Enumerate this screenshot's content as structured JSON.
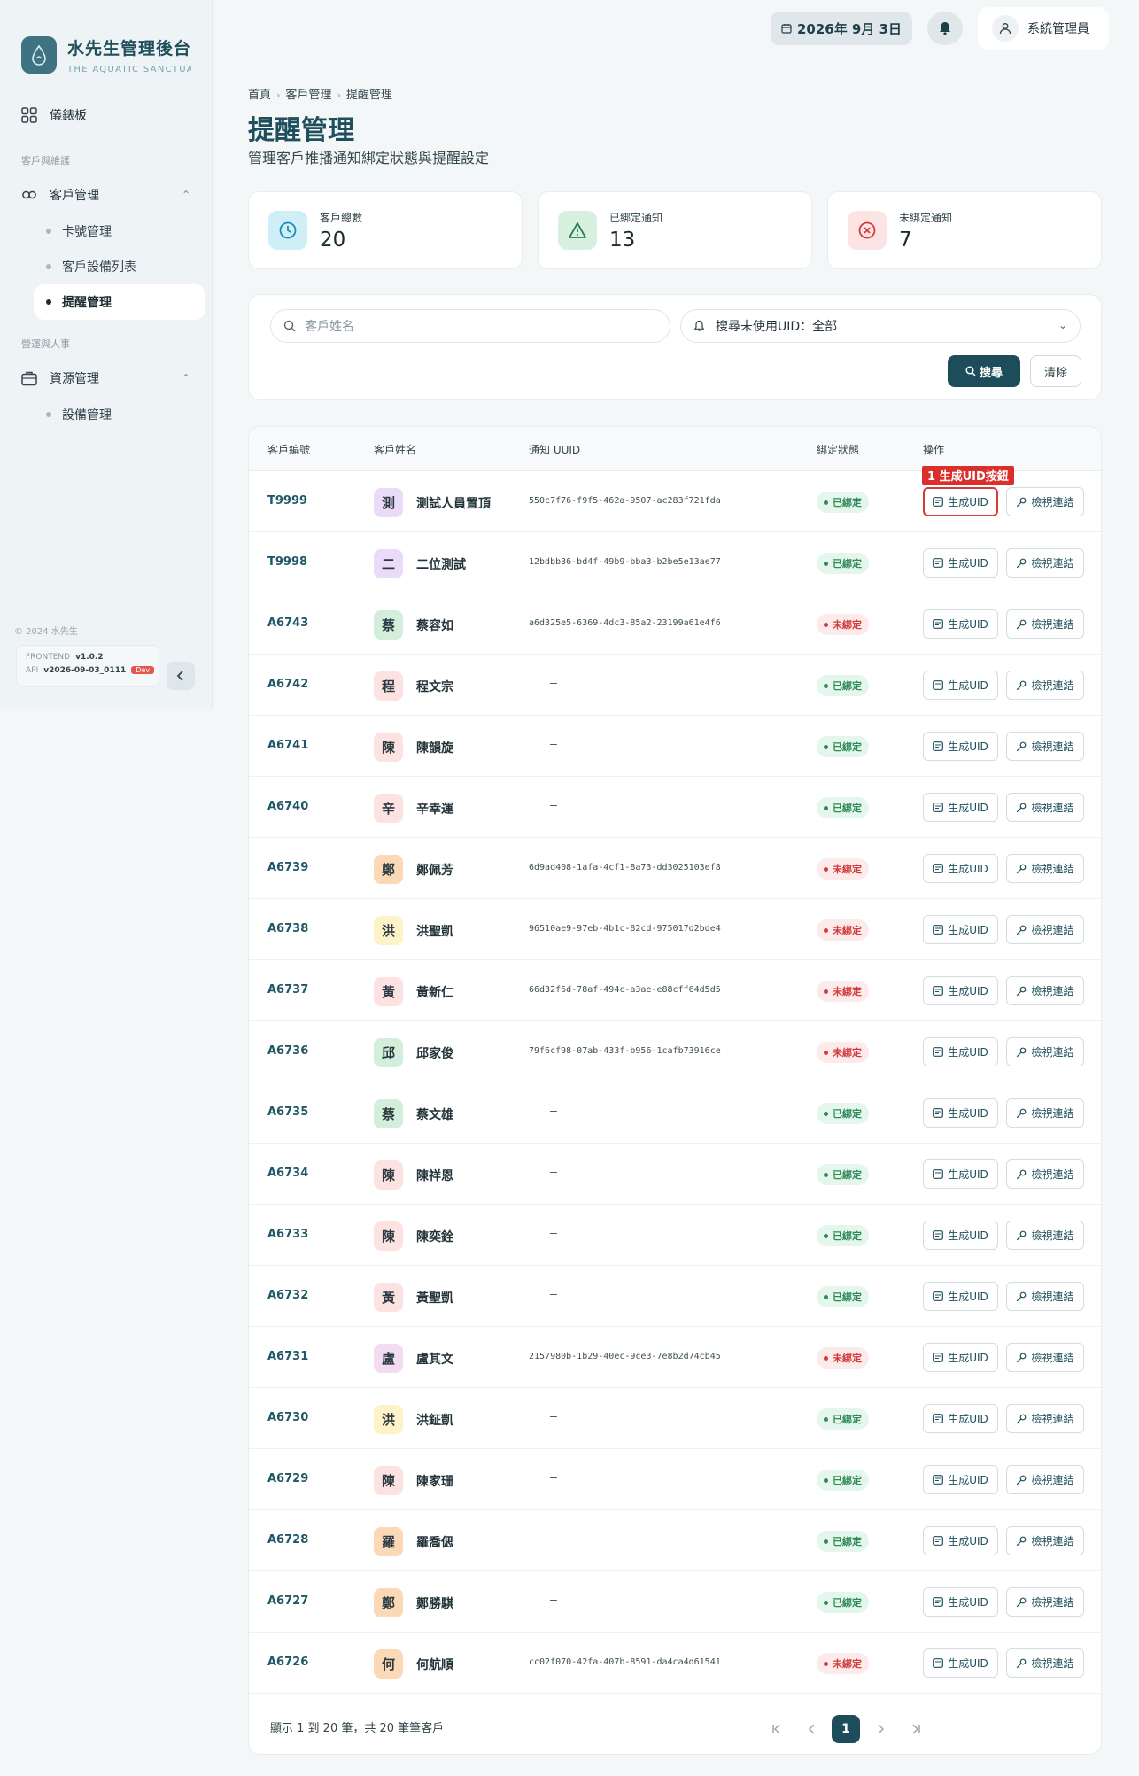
{
  "brand": {
    "title": "水先生管理後台",
    "subtitle": "THE AQUATIC SANCTUARY"
  },
  "sidebar": {
    "dashboard": "儀錶板",
    "section_customers": "客戶與維護",
    "customer_mgmt": "客戶管理",
    "sub_items": [
      "卡號管理",
      "客戶設備列表",
      "提醒管理"
    ],
    "section_ops": "營運與人事",
    "resource_mgmt": "資源管理",
    "resource_sub": "設備管理",
    "copyright": "© 2024 水先生",
    "frontend_label": "FRONTEND",
    "frontend_version": "v1.0.2",
    "api_label": "API",
    "api_version": "v2026-09-03_0111",
    "env_badge": "Dev"
  },
  "topbar": {
    "date": "2026年 9月 3日",
    "user": "系統管理員"
  },
  "header": {
    "breadcrumb": [
      "首頁",
      "客戶管理",
      "提醒管理"
    ],
    "title": "提醒管理",
    "subtitle": "管理客戶推播通知綁定狀態與提醒設定"
  },
  "stats": [
    {
      "label": "客戶總數",
      "value": "20",
      "icon": "clock-icon",
      "bg": "#cfeef8",
      "color": "#1b8fb8"
    },
    {
      "label": "已綁定通知",
      "value": "13",
      "icon": "warning-icon",
      "bg": "#d7f0e0",
      "color": "#2e7d4f"
    },
    {
      "label": "未綁定通知",
      "value": "7",
      "icon": "x-circle-icon",
      "bg": "#fde4e4",
      "color": "#d23b3b"
    }
  ],
  "filter": {
    "search_placeholder": "客戶姓名",
    "select_value": "搜尋未使用UID：全部",
    "search_button": "搜尋",
    "clear_button": "清除"
  },
  "table": {
    "headers": [
      "客戶編號",
      "客戶姓名",
      "通知 UUID",
      "綁定狀態",
      "操作"
    ],
    "uid_button": "生成UID",
    "link_button": "檢視連結",
    "bound_label": "已綁定",
    "unbound_label": "未綁定",
    "annotation": "1 生成UID按鈕",
    "rows": [
      {
        "id": "T9999",
        "initial": "測",
        "name": "測試人員置頂",
        "uuid": "550c7f76-f9f5-462a-9507-ac283f721fda",
        "bound": true,
        "avatar_bg": "#eadcf8"
      },
      {
        "id": "T9998",
        "initial": "二",
        "name": "二位測試",
        "uuid": "12bdbb36-bd4f-49b9-bba3-b2be5e13ae77",
        "bound": true,
        "avatar_bg": "#eadcf8"
      },
      {
        "id": "A6743",
        "initial": "蔡",
        "name": "蔡容如",
        "uuid": "a6d325e5-6369-4dc3-85a2-23199a61e4f6",
        "bound": false,
        "avatar_bg": "#d3efdc"
      },
      {
        "id": "A6742",
        "initial": "程",
        "name": "程文宗",
        "uuid": "—",
        "bound": true,
        "avatar_bg": "#fde2e2"
      },
      {
        "id": "A6741",
        "initial": "陳",
        "name": "陳韻旋",
        "uuid": "—",
        "bound": true,
        "avatar_bg": "#fde2e2"
      },
      {
        "id": "A6740",
        "initial": "辛",
        "name": "辛幸運",
        "uuid": "—",
        "bound": true,
        "avatar_bg": "#fde2e2"
      },
      {
        "id": "A6739",
        "initial": "鄭",
        "name": "鄭佩芳",
        "uuid": "6d9ad408-1afa-4cf1-8a73-dd3025103ef8",
        "bound": false,
        "avatar_bg": "#fcd9b6"
      },
      {
        "id": "A6738",
        "initial": "洪",
        "name": "洪聖凱",
        "uuid": "96510ae9-97eb-4b1c-82cd-975017d2bde4",
        "bound": false,
        "avatar_bg": "#fdf2c8"
      },
      {
        "id": "A6737",
        "initial": "黃",
        "name": "黃新仁",
        "uuid": "66d32f6d-78af-494c-a3ae-e88cff64d5d5",
        "bound": false,
        "avatar_bg": "#fde2e2"
      },
      {
        "id": "A6736",
        "initial": "邱",
        "name": "邱家俊",
        "uuid": "79f6cf98-07ab-433f-b956-1cafb73916ce",
        "bound": false,
        "avatar_bg": "#d3efdc"
      },
      {
        "id": "A6735",
        "initial": "蔡",
        "name": "蔡文雄",
        "uuid": "—",
        "bound": true,
        "avatar_bg": "#d3efdc"
      },
      {
        "id": "A6734",
        "initial": "陳",
        "name": "陳祥恩",
        "uuid": "—",
        "bound": true,
        "avatar_bg": "#fde2e2"
      },
      {
        "id": "A6733",
        "initial": "陳",
        "name": "陳奕銓",
        "uuid": "—",
        "bound": true,
        "avatar_bg": "#fde2e2"
      },
      {
        "id": "A6732",
        "initial": "黃",
        "name": "黃聖凱",
        "uuid": "—",
        "bound": true,
        "avatar_bg": "#fde2e2"
      },
      {
        "id": "A6731",
        "initial": "盧",
        "name": "盧其文",
        "uuid": "2157980b-1b29-40ec-9ce3-7e8b2d74cb45",
        "bound": false,
        "avatar_bg": "#f3dcf1"
      },
      {
        "id": "A6730",
        "initial": "洪",
        "name": "洪鉦凱",
        "uuid": "—",
        "bound": true,
        "avatar_bg": "#fdf2c8"
      },
      {
        "id": "A6729",
        "initial": "陳",
        "name": "陳家珊",
        "uuid": "—",
        "bound": true,
        "avatar_bg": "#fde2e2"
      },
      {
        "id": "A6728",
        "initial": "羅",
        "name": "羅喬偲",
        "uuid": "—",
        "bound": true,
        "avatar_bg": "#fcd9b6"
      },
      {
        "id": "A6727",
        "initial": "鄭",
        "name": "鄭勝騏",
        "uuid": "—",
        "bound": true,
        "avatar_bg": "#fcd9b6"
      },
      {
        "id": "A6726",
        "initial": "何",
        "name": "何航順",
        "uuid": "cc02f070-42fa-407b-8591-da4ca4d61541",
        "bound": false,
        "avatar_bg": "#fcd9b6"
      }
    ]
  },
  "pagination": {
    "summary": "顯示 1 到 20 筆，共 20 筆筆客戶",
    "current": "1"
  },
  "colors": {
    "accent": "#1d4d5b",
    "bound": "#2e8b57",
    "unbound": "#d23b3b"
  }
}
